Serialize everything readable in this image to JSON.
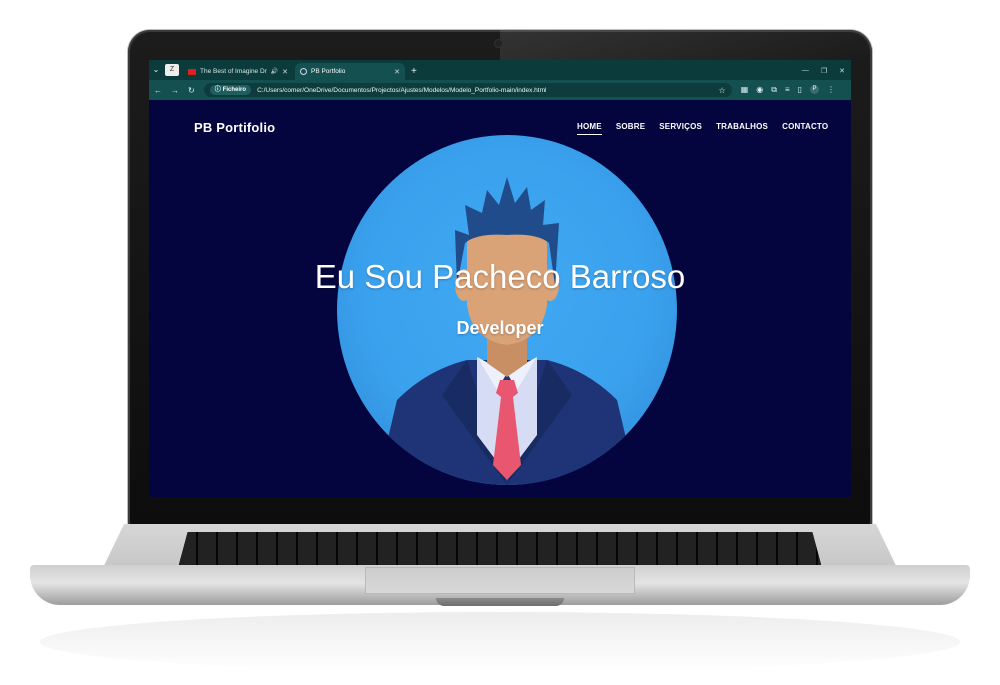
{
  "browser": {
    "tabs": [
      {
        "title": "The Best of Imagine Drago",
        "favicon": "youtube-icon",
        "audio": true,
        "active": false
      },
      {
        "title": "PB Portfolio",
        "favicon": "globe-icon",
        "audio": false,
        "active": true
      }
    ],
    "pinned_tab_label": "Z",
    "address": {
      "chip_label": "Ficheiro",
      "url": "C:/Users/comer/OneDrive/Documentos/Projectos/Ajustes/Modelos/Modelo_Portfolio-main/index.html"
    },
    "profile_initial": "P"
  },
  "site": {
    "brand": "PB Portifolio",
    "nav": [
      {
        "label": "HOME",
        "active": true
      },
      {
        "label": "SOBRE",
        "active": false
      },
      {
        "label": "SERVIÇOS",
        "active": false
      },
      {
        "label": "TRABALHOS",
        "active": false
      },
      {
        "label": "CONTACTO",
        "active": false
      }
    ],
    "hero": {
      "title": "Eu Sou Pacheco Barroso",
      "subtitle": "Developer"
    }
  },
  "colors": {
    "page_background": "#04043f",
    "circle": "#3aa1ee",
    "suit": "#1f3476",
    "tie": "#e8566f",
    "hair": "#214c8c",
    "skin": "#d9a277",
    "chrome": "#0b3b3b"
  }
}
